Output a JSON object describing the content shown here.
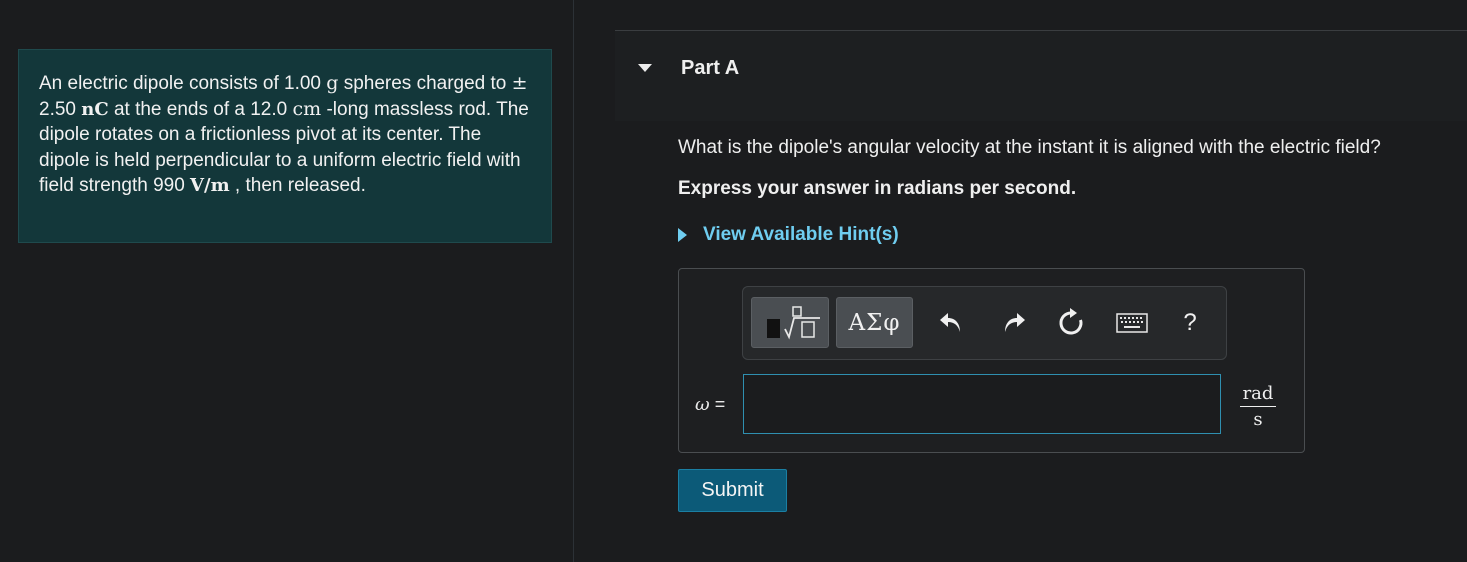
{
  "problem": {
    "segments": [
      {
        "t": "An electric dipole consists of 1.00 "
      },
      {
        "m": "g"
      },
      {
        "t": " spheres charged to "
      },
      {
        "m": "±"
      },
      {
        "t": " 2.50 "
      },
      {
        "mb": "nC"
      },
      {
        "t": " at the ends of a 12.0 "
      },
      {
        "m": "cm"
      },
      {
        "t": " -long massless rod. The dipole rotates on a frictionless pivot at its center. The dipole is held perpendicular to a uniform electric field with field strength 990 "
      },
      {
        "mb": "V/m"
      },
      {
        "t": " , then released."
      }
    ]
  },
  "part": {
    "title": "Part A",
    "question": "What is the dipole's angular velocity at the instant it is aligned with the electric field?",
    "instruction": "Express your answer in radians per second.",
    "hint_label": "View Available Hint(s)"
  },
  "toolbar": {
    "templates_icon": "template-fraction-sqrt-icon",
    "greek_label": "ΑΣφ",
    "undo_icon": "undo-icon",
    "redo_icon": "redo-icon",
    "reset_icon": "reset-icon",
    "keyboard_icon": "keyboard-icon",
    "help_label": "?"
  },
  "answer": {
    "variable": "ω",
    "equals": "=",
    "value": "",
    "unit_numerator": "rad",
    "unit_denominator": "s"
  },
  "submit_label": "Submit",
  "colors": {
    "problem_bg": "#13373a",
    "link": "#6fcdf0",
    "submit_bg": "#0c5a78",
    "input_border": "#2f8fb0"
  }
}
